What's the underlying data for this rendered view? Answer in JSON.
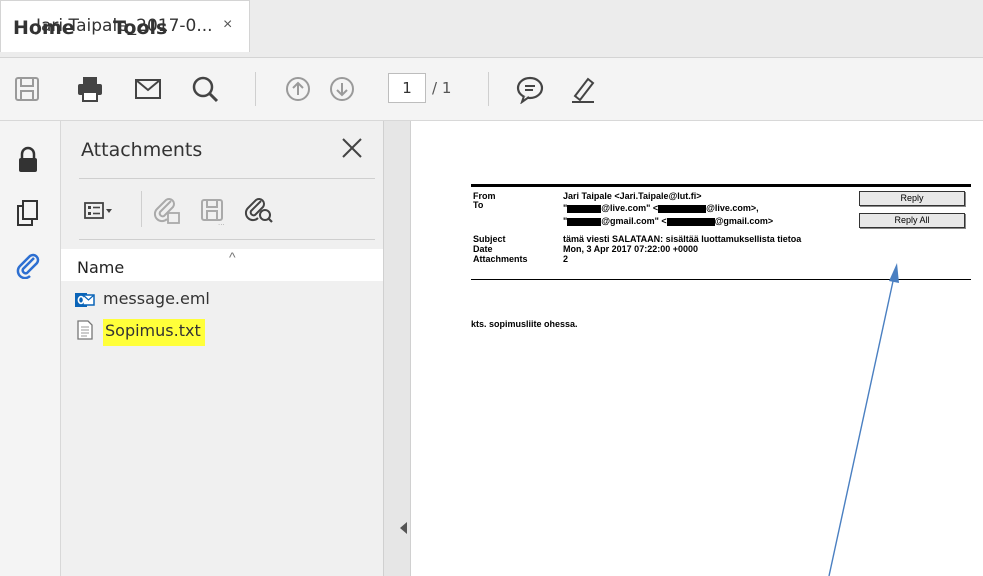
{
  "menu": {
    "home": "Home",
    "tools": "Tools"
  },
  "tab": {
    "title": "Jari.Taipale_2017-0...",
    "close": "×"
  },
  "toolbar": {
    "page_current": "1",
    "page_total": "/ 1"
  },
  "panel": {
    "title": "Attachments",
    "column_name": "Name",
    "sort_caret": "^",
    "files": [
      {
        "name": "message.eml",
        "icon": "outlook-icon"
      },
      {
        "name": "Sopimus.txt",
        "icon": "text-file-icon",
        "highlighted": true
      }
    ]
  },
  "email": {
    "labels": {
      "from": "From",
      "to": "To",
      "subject": "Subject",
      "date": "Date",
      "attachments": "Attachments"
    },
    "from": "Jari Taipale <Jari.Taipale@lut.fi>",
    "to_line1_a": "\"",
    "to_line1_b": "@live.com\" <",
    "to_line1_c": "@live.com>,",
    "to_line2_a": "\"",
    "to_line2_b": "@gmail.com\" <",
    "to_line2_c": "@gmail.com>",
    "subject": "tämä viesti SALATAAN:  sisältää luottamuksellista tietoa",
    "date": "Mon, 3 Apr 2017 07:22:00 +0000",
    "attachments": "2",
    "reply_label": "Reply",
    "reply_all_label": "Reply All",
    "body": "kts. sopimusliite ohessa."
  },
  "colors": {
    "highlight": "#ffff3a",
    "annotation_arrow": "#4a7fc1",
    "attachment_clip": "#2d6fd1"
  }
}
